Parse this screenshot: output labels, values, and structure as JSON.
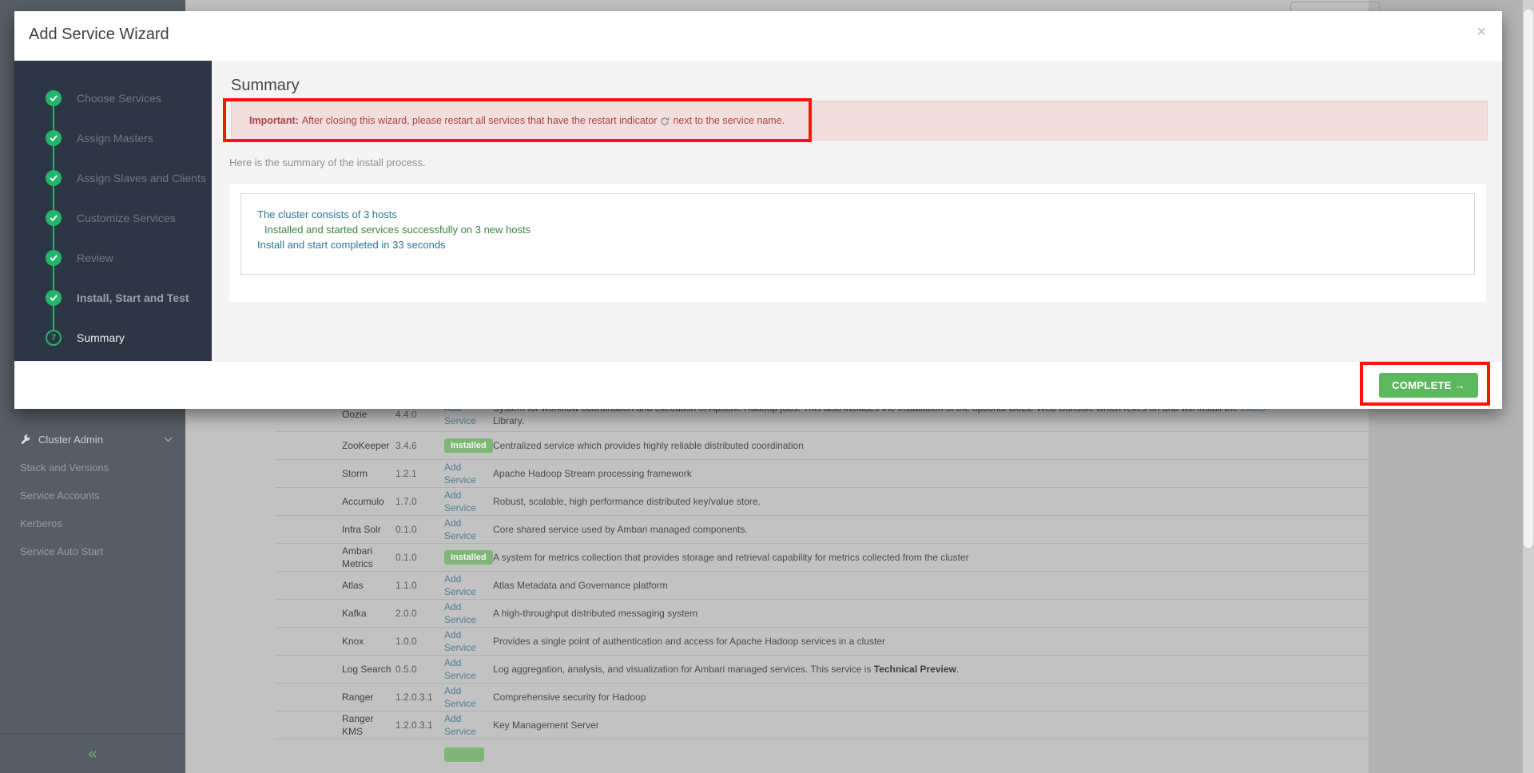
{
  "app": {
    "sidebar": {
      "items": [
        {
          "label": "Cluster Admin",
          "icon": "wrench-icon",
          "chevron": "chevron-down-icon",
          "head": true
        },
        {
          "label": "Stack and Versions"
        },
        {
          "label": "Service Accounts"
        },
        {
          "label": "Kerberos"
        },
        {
          "label": "Service Auto Start"
        }
      ],
      "collapse_glyph": "«"
    },
    "services_table": {
      "rows": [
        {
          "name": "Oozie",
          "version": "4.4.0",
          "action": {
            "type": "link",
            "label": "Add Service"
          },
          "desc": [
            {
              "t": "System for workflow coordination and execution of Apache Hadoop jobs. This also includes the installation of the optional Oozie Web Console which relies on and will install the "
            },
            {
              "t": "ExtJS",
              "s": "link"
            },
            {
              "t": " Library."
            }
          ]
        },
        {
          "name": "ZooKeeper",
          "version": "3.4.6",
          "action": {
            "type": "badge",
            "label": "Installed"
          },
          "desc": [
            {
              "t": "Centralized service which provides highly reliable distributed coordination"
            }
          ]
        },
        {
          "name": "Storm",
          "version": "1.2.1",
          "action": {
            "type": "link",
            "label": "Add Service"
          },
          "desc": [
            {
              "t": "Apache Hadoop Stream processing framework"
            }
          ]
        },
        {
          "name": "Accumulo",
          "version": "1.7.0",
          "action": {
            "type": "link",
            "label": "Add Service"
          },
          "desc": [
            {
              "t": "Robust, scalable, high performance distributed key/value store."
            }
          ]
        },
        {
          "name": "Infra Solr",
          "version": "0.1.0",
          "action": {
            "type": "link",
            "label": "Add Service"
          },
          "desc": [
            {
              "t": "Core shared service used by Ambari managed components."
            }
          ]
        },
        {
          "name": "Ambari Metrics",
          "version": "0.1.0",
          "action": {
            "type": "badge",
            "label": "Installed"
          },
          "desc": [
            {
              "t": "A system for metrics collection that provides storage and retrieval capability for metrics collected from the cluster"
            }
          ]
        },
        {
          "name": "Atlas",
          "version": "1.1.0",
          "action": {
            "type": "link",
            "label": "Add Service"
          },
          "desc": [
            {
              "t": "Atlas Metadata and Governance platform"
            }
          ]
        },
        {
          "name": "Kafka",
          "version": "2.0.0",
          "action": {
            "type": "link",
            "label": "Add Service"
          },
          "desc": [
            {
              "t": "A high-throughput distributed messaging system"
            }
          ]
        },
        {
          "name": "Knox",
          "version": "1.0.0",
          "action": {
            "type": "link",
            "label": "Add Service"
          },
          "desc": [
            {
              "t": "Provides a single point of authentication and access for Apache Hadoop services in a cluster"
            }
          ]
        },
        {
          "name": "Log Search",
          "version": "0.5.0",
          "action": {
            "type": "link",
            "label": "Add Service"
          },
          "desc": [
            {
              "t": "Log aggregation, analysis, and visualization for Ambari managed services. This service is "
            },
            {
              "t": "Technical Preview",
              "s": "bold"
            },
            {
              "t": "."
            }
          ]
        },
        {
          "name": "Ranger",
          "version": "1.2.0.3.1",
          "action": {
            "type": "link",
            "label": "Add Service"
          },
          "desc": [
            {
              "t": "Comprehensive security for Hadoop"
            }
          ]
        },
        {
          "name": "Ranger KMS",
          "version": "1.2.0.3.1",
          "action": {
            "type": "link",
            "label": "Add Service"
          },
          "desc": [
            {
              "t": "Key Management Server"
            }
          ]
        }
      ]
    }
  },
  "wizard": {
    "title": "Add Service Wizard",
    "close_glyph": "×",
    "steps": [
      {
        "label": "Choose Services",
        "state": "done",
        "style": "muted"
      },
      {
        "label": "Assign Masters",
        "state": "done",
        "style": "muted"
      },
      {
        "label": "Assign Slaves and Clients",
        "state": "done",
        "style": "muted"
      },
      {
        "label": "Customize Services",
        "state": "done",
        "style": "muted"
      },
      {
        "label": "Review",
        "state": "done",
        "style": "muted"
      },
      {
        "label": "Install, Start and Test",
        "state": "done",
        "style": "strong"
      },
      {
        "label": "Summary",
        "state": "current",
        "number": "7",
        "style": "active"
      }
    ],
    "summary": {
      "heading": "Summary",
      "warning": {
        "prefix": "Important:",
        "before_icon": "After closing this wizard, please restart all services that have the restart indicator",
        "icon": "restart-icon",
        "after_icon": "next to the service name."
      },
      "intro": "Here is the summary of the install process.",
      "lines": [
        {
          "text": "The cluster consists of 3 hosts",
          "color": "blue",
          "link": true
        },
        {
          "text": "Installed and started services successfully on 3 new hosts",
          "color": "green",
          "link": false,
          "indent": true
        },
        {
          "text": "Install and start completed in 33 seconds",
          "color": "blue",
          "link": true
        }
      ]
    },
    "footer": {
      "complete_label": "COMPLETE →"
    }
  },
  "colors": {
    "accent_green": "#23b56b",
    "button_green": "#5cb85c",
    "annotation_red": "#fb1408",
    "warning_bg": "#f3dede",
    "warning_text": "#a94442",
    "link_blue": "#2e7597",
    "success_text": "#3d8540",
    "wizard_nav_bg": "#2d3644",
    "badge_green": "#7fb576"
  }
}
